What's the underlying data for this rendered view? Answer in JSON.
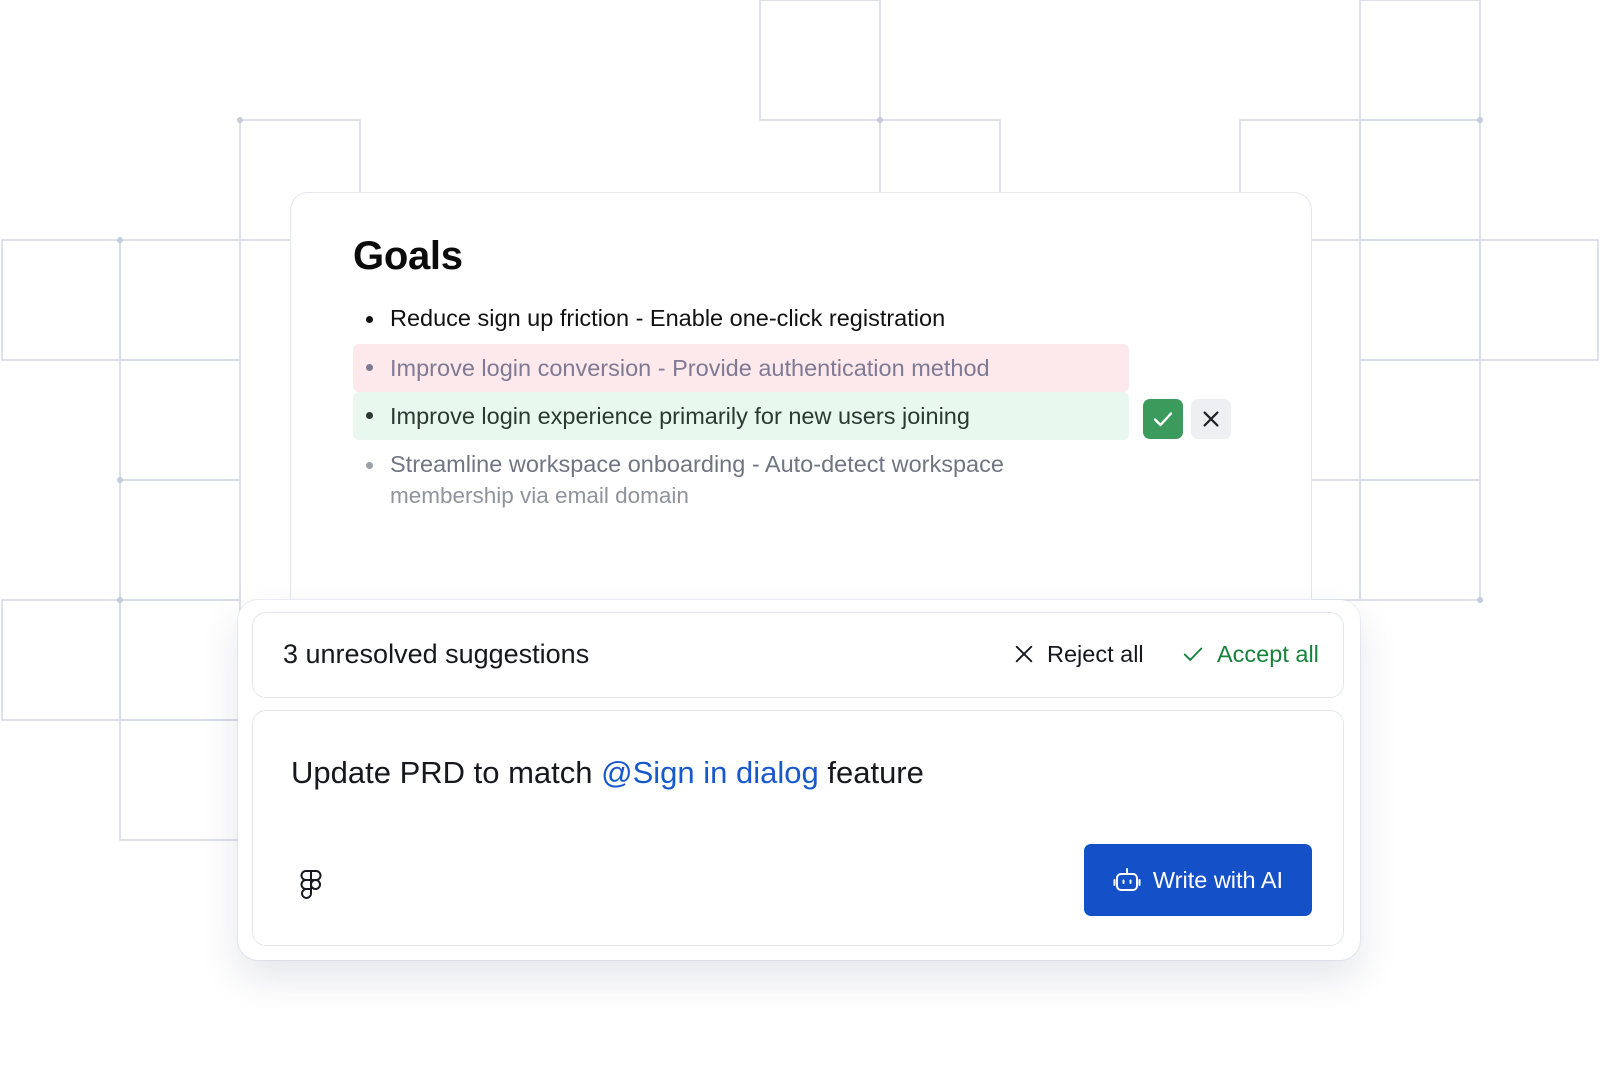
{
  "document": {
    "heading": "Goals",
    "goals": [
      {
        "text": "Reduce sign up friction - Enable one-click registration",
        "state": "existing"
      },
      {
        "text": "Improve login conversion - Provide authentication method",
        "state": "removed"
      },
      {
        "text": "Improve login experience primarily for new users joining",
        "state": "added"
      },
      {
        "text_line1": "Streamline workspace onboarding - Auto-detect workspace",
        "text_line2": "membership via email domain",
        "state": "faded"
      }
    ],
    "suggestion_actions": {
      "accept_icon": "check-icon",
      "reject_icon": "close-icon"
    }
  },
  "suggestions_bar": {
    "count_label": "3 unresolved suggestions",
    "reject_all_label": "Reject all",
    "accept_all_label": "Accept all"
  },
  "composer": {
    "prompt_before": "Update PRD to match ",
    "mention": "@Sign in dialog",
    "prompt_after": " feature",
    "attachment_icon": "figma-icon",
    "write_ai_label": "Write with AI",
    "write_ai_icon": "robot-icon"
  },
  "colors": {
    "accent_blue": "#1450c8",
    "mention_blue": "#1659cc",
    "accept_green": "#17823a",
    "removed_bg": "#fde8ec",
    "added_bg": "#e9f8ee",
    "grid_line": "#d3d7e4"
  }
}
